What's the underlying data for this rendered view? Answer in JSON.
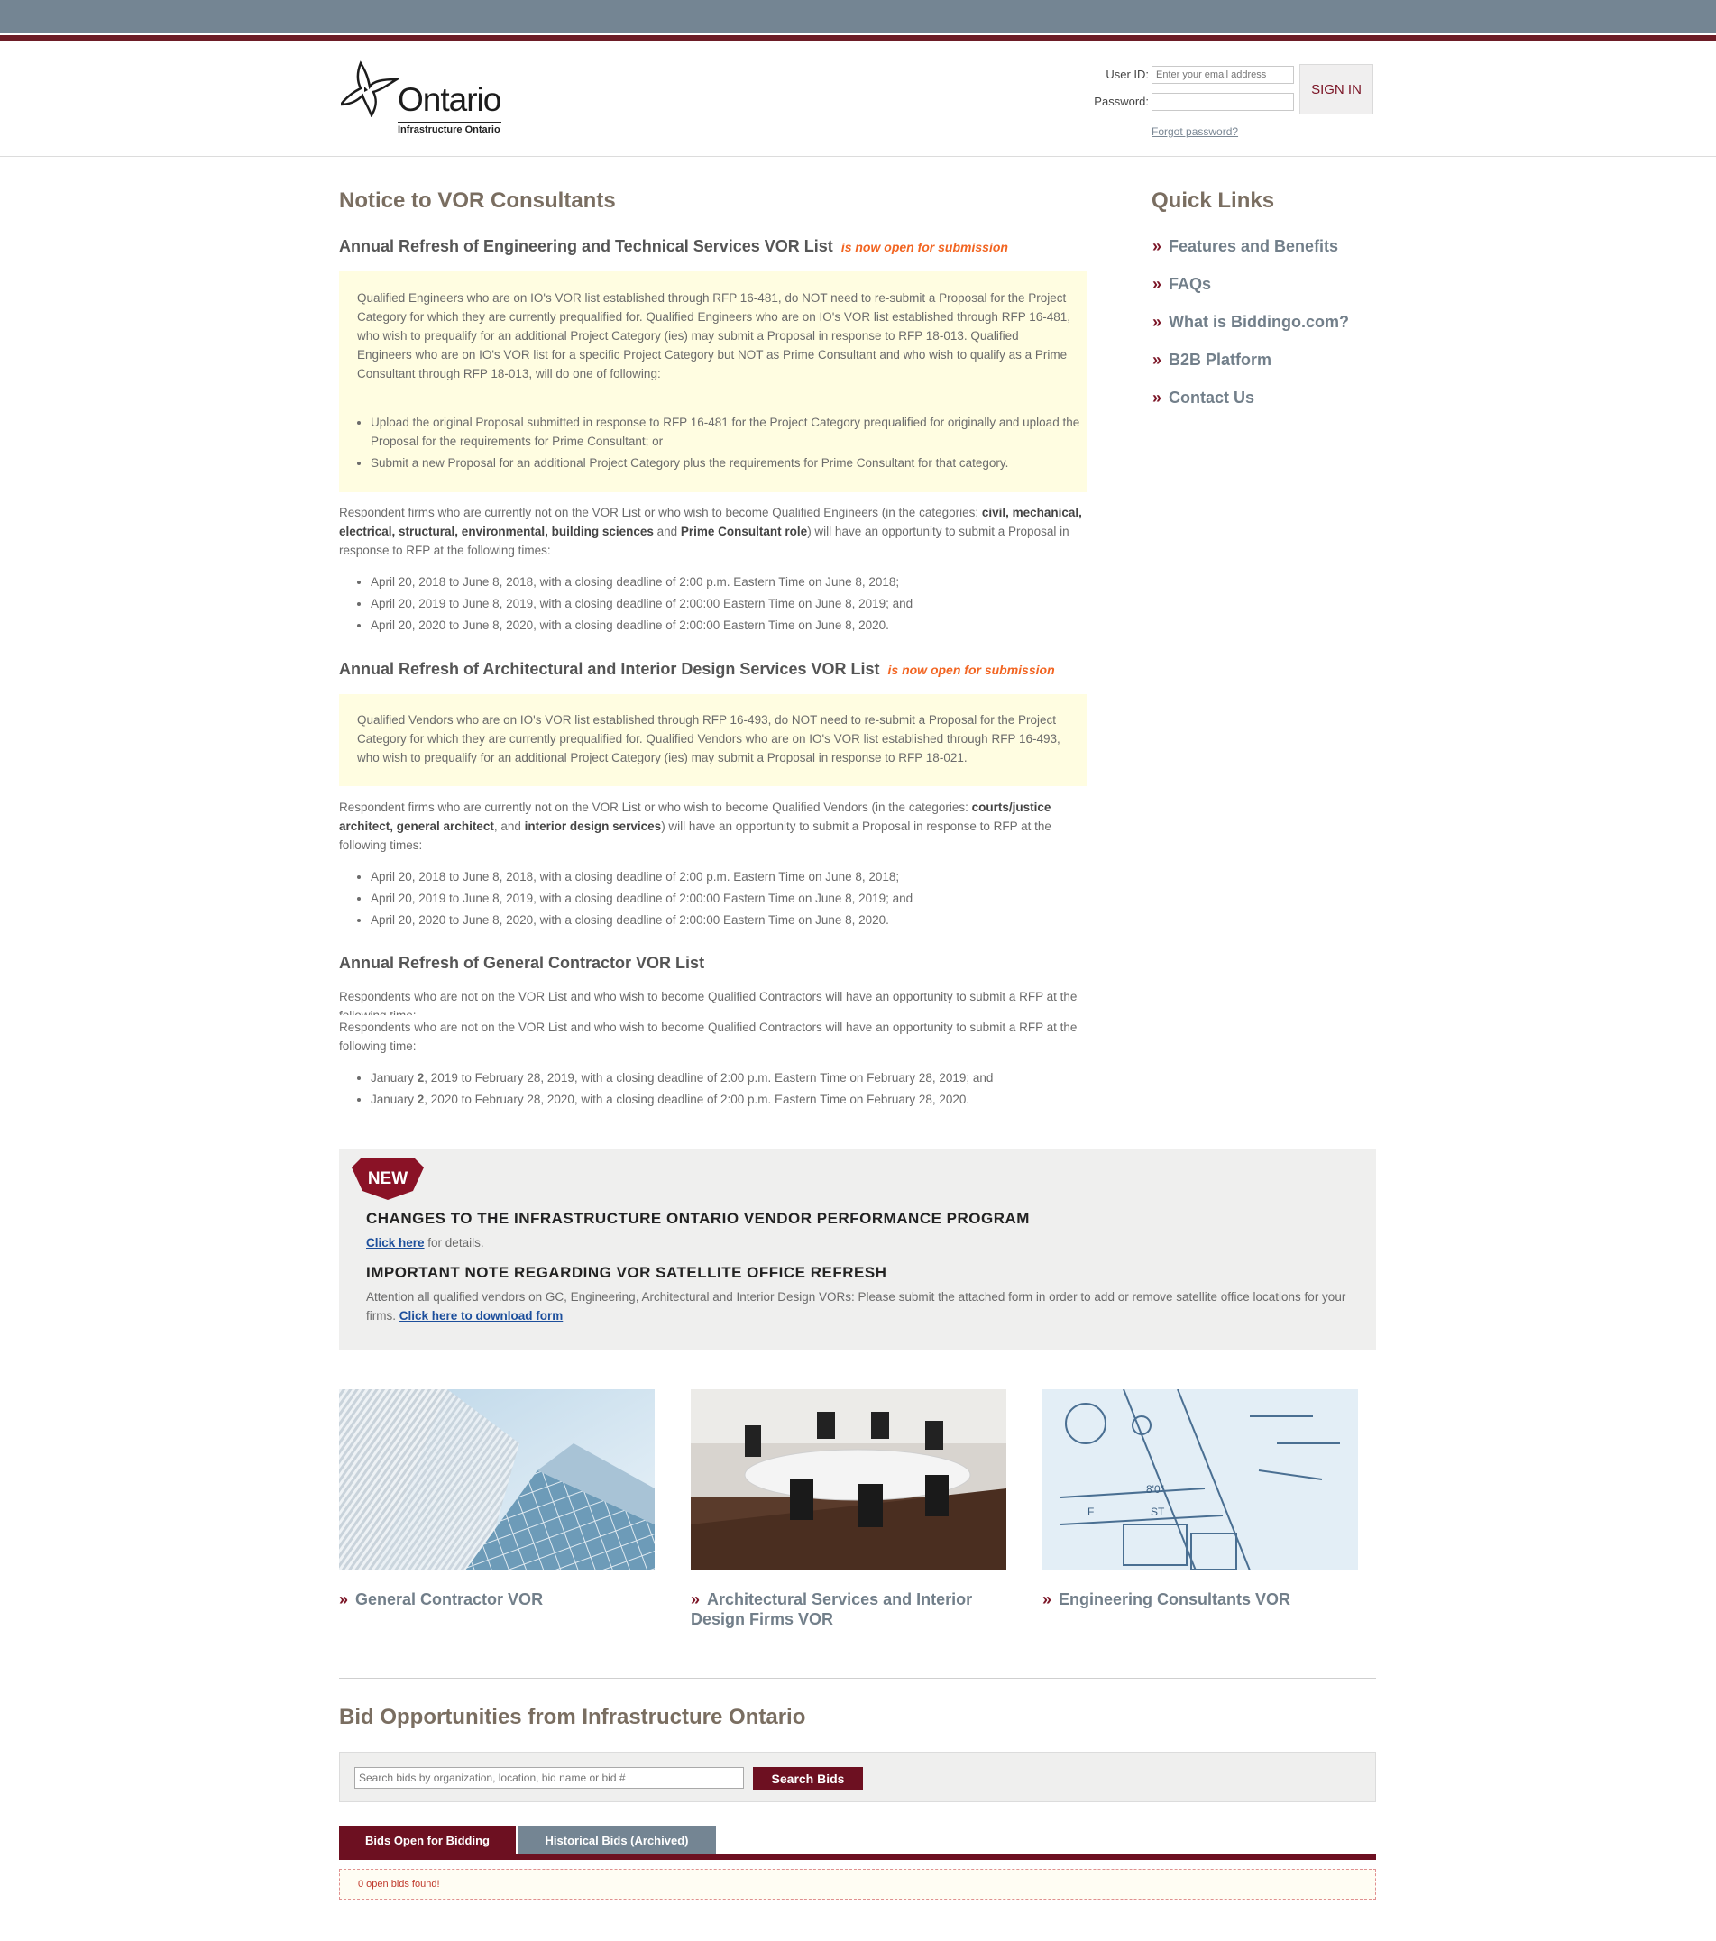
{
  "header": {
    "logo_word": "Ontario",
    "logo_sub": "Infrastructure Ontario",
    "user_id_label": "User ID:",
    "user_id_placeholder": "Enter your email address",
    "password_label": "Password:",
    "sign_in": "SIGN IN",
    "forgot": "Forgot password?"
  },
  "main": {
    "title": "Notice to VOR Consultants",
    "sections": [
      {
        "heading": "Annual Refresh of Engineering and Technical Services VOR List",
        "highlight": "is now open for submission",
        "note": "Qualified Engineers who are on IO's VOR list established through RFP 16-481, do NOT need to re-submit a Proposal for the Project Category for which they are currently prequalified for. Qualified Engineers who are on IO's VOR list established through RFP 16-481, who wish to prequalify for an additional Project Category (ies) may submit a Proposal in response to RFP 18-013. Qualified Engineers who are on IO's VOR list for a specific Project Category but NOT as Prime Consultant and who wish to qualify as a Prime Consultant through RFP 18-013, will do one of following:",
        "note_bullets": [
          "Upload the original Proposal submitted in response to RFP 16-481 for the Project Category prequalified for originally and upload the Proposal for the requirements for Prime Consultant; or",
          "Submit a new Proposal for an additional Project Category plus the requirements for Prime Consultant for that category."
        ],
        "respondents": {
          "pre": "Respondent firms who are currently not on the VOR List or who wish to become Qualified Engineers (in the categories: ",
          "bold1": "civil, mechanical, electrical, structural, environmental, building sciences",
          "mid": " and ",
          "bold2": "Prime Consultant role",
          "post": ") will have an opportunity to submit a Proposal in response to RFP at the following times:"
        },
        "dates": [
          "April 20, 2018 to June 8, 2018, with a closing deadline of 2:00 p.m. Eastern Time on June 8, 2018;",
          "April 20, 2019 to June 8, 2019, with a closing deadline of 2:00:00 Eastern Time on June 8, 2019; and",
          "April 20, 2020 to June 8, 2020, with a closing deadline of 2:00:00 Eastern Time on June 8, 2020."
        ]
      },
      {
        "heading": "Annual Refresh of Architectural and Interior Design Services VOR List",
        "highlight": "is now open for submission",
        "note": "Qualified Vendors who are on IO's VOR list established through RFP 16-493, do NOT need to re-submit a Proposal for the Project Category for which they are currently prequalified for. Qualified Vendors who are on IO's VOR list established through RFP 16-493, who wish to prequalify for an additional Project Category (ies) may submit a Proposal in response to RFP 18-021.",
        "respondents": {
          "pre": "Respondent firms who are currently not on the VOR List or who wish to become Qualified Vendors (in the categories: ",
          "bold1": "courts/justice architect, general architect",
          "mid": ", and ",
          "bold2": "interior design services",
          "post": ") will have an opportunity to submit a Proposal in response to RFP at the following times:"
        },
        "dates": [
          "April 20, 2018 to June 8, 2018, with a closing deadline of 2:00 p.m. Eastern Time on June 8, 2018;",
          "April 20, 2019 to June 8, 2019, with a closing deadline of 2:00:00 Eastern Time on June 8, 2019; and",
          "April 20, 2020 to June 8, 2020, with a closing deadline of 2:00:00 Eastern Time on June 8, 2020."
        ]
      },
      {
        "heading": "Annual Refresh of General Contractor VOR List",
        "para_clipped": "Respondents who are not on the VOR List and who wish to become Qualified Contractors will have an opportunity to submit a RFP at the following time:",
        "para": "Respondents who are not on the VOR List and who wish to become Qualified Contractors will have an opportunity to submit a RFP at the following time:",
        "dates": [
          {
            "pre": "January ",
            "bold": "2",
            "post": ", 2019 to February 28, 2019, with a closing deadline of 2:00 p.m. Eastern Time on February 28, 2019; and"
          },
          {
            "pre": "January ",
            "bold": "2",
            "post": ", 2020 to February 28, 2020, with a closing deadline of 2:00 p.m. Eastern Time on February 28, 2020."
          }
        ]
      }
    ]
  },
  "quick_links": {
    "title": "Quick Links",
    "items": [
      "Features and Benefits",
      "FAQs",
      "What is Biddingo.com?",
      "B2B Platform",
      "Contact Us"
    ]
  },
  "announcement": {
    "badge": "NEW",
    "heading1": "CHANGES TO THE INFRASTRUCTURE ONTARIO VENDOR PERFORMANCE PROGRAM",
    "link1": "Click here",
    "text1": " for details.",
    "heading2": "IMPORTANT NOTE REGARDING VOR SATELLITE OFFICE REFRESH",
    "text2": "Attention all qualified vendors on GC, Engineering, Architectural and Interior Design VORs: Please submit the attached form in order to add or remove satellite office locations for your firms. ",
    "link2": "Click here to download form"
  },
  "vor_cards": [
    {
      "label": "General Contractor VOR",
      "image": "glass-building-image"
    },
    {
      "label": "Architectural Services and Interior Design Firms VOR",
      "image": "boardroom-image"
    },
    {
      "label": "Engineering Consultants VOR",
      "image": "blueprint-image"
    }
  ],
  "bids": {
    "title": "Bid Opportunities from Infrastructure Ontario",
    "search_placeholder": "Search bids by organization, location, bid name or bid #",
    "search_button": "Search Bids",
    "tabs": [
      "Bids Open for Bidding",
      "Historical Bids (Archived)"
    ],
    "results": "0 open bids found!"
  },
  "colors": {
    "brand": "#6d1021",
    "topbar": "#748593",
    "link": "#727f8a",
    "highlight": "#f26522",
    "note_bg": "#fffde1"
  }
}
